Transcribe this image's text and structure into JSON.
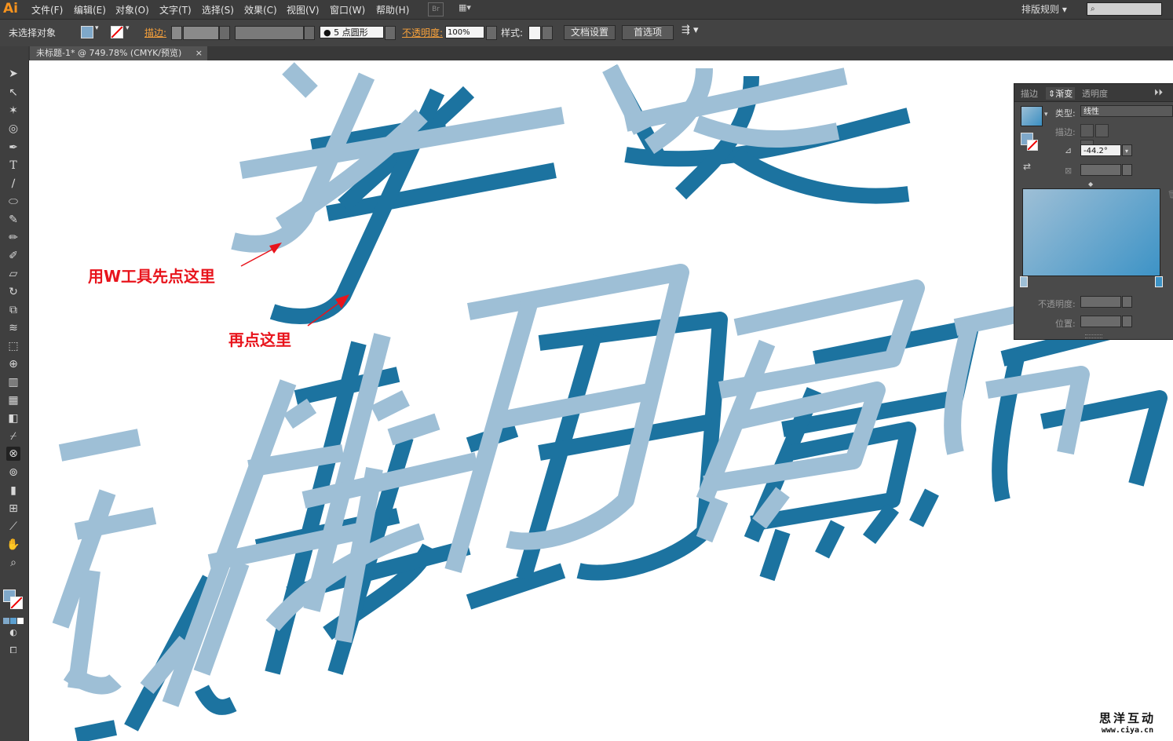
{
  "app": {
    "logo": "Ai"
  },
  "menus": [
    "文件(F)",
    "编辑(E)",
    "对象(O)",
    "文字(T)",
    "选择(S)",
    "效果(C)",
    "视图(V)",
    "窗口(W)",
    "帮助(H)"
  ],
  "menubar": {
    "br_label": "Br",
    "workspace": "排版规则",
    "search_placeholder": ""
  },
  "control": {
    "selection_status": "未选择对象",
    "stroke_label": "描边:",
    "brush_label": "5 点圆形",
    "opacity_label": "不透明度:",
    "opacity_value": "100%",
    "style_label": "样式:",
    "doc_setup": "文档设置",
    "preferences": "首选项"
  },
  "document": {
    "tab_title": "未标题-1* @ 749.78% (CMYK/预览)",
    "close": "×"
  },
  "gradient_panel": {
    "tabs": [
      "描边",
      "渐变",
      "透明度"
    ],
    "active_tab": "渐变",
    "type_label": "类型:",
    "type_value": "线性",
    "stroke_label": "描边:",
    "angle_value": "-44.2°",
    "opacity_label": "不透明度:",
    "position_label": "位置:"
  },
  "annotations": {
    "first": "用W工具先点这里",
    "second": "再点这里"
  },
  "watermark": {
    "name": "思洋互动",
    "url": "www.ciya.cn"
  },
  "colors": {
    "light_blue": "#9ebfd6",
    "dark_blue": "#1c73a0",
    "annotation_red": "#e8141c",
    "ui_dark": "#3c3c3c"
  }
}
